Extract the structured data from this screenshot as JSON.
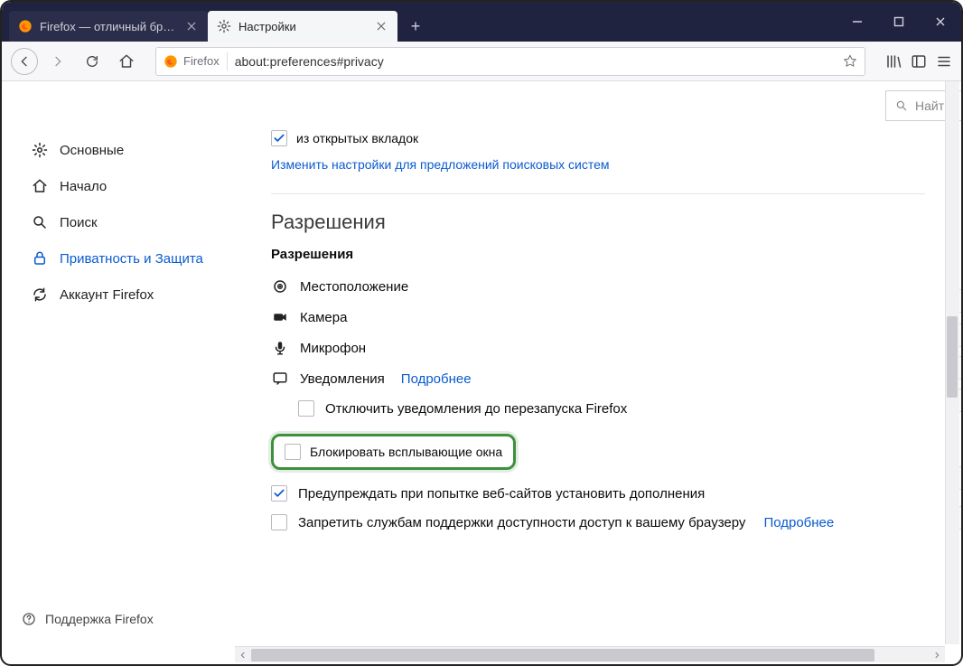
{
  "tabs": [
    {
      "title": "Firefox — отличный браузер д",
      "active": false
    },
    {
      "title": "Настройки",
      "active": true
    }
  ],
  "urlbar": {
    "brand": "Firefox",
    "address": "about:preferences#privacy"
  },
  "sidebar": {
    "items": [
      {
        "label": "Основные",
        "icon": "gear"
      },
      {
        "label": "Начало",
        "icon": "home"
      },
      {
        "label": "Поиск",
        "icon": "search"
      },
      {
        "label": "Приватность и Защита",
        "icon": "lock",
        "active": true
      },
      {
        "label": "Аккаунт Firefox",
        "icon": "sync"
      }
    ],
    "support": "Поддержка Firefox"
  },
  "search_placeholder": "Найт",
  "top_checkbox": {
    "checked": true,
    "label": "из открытых вкладок"
  },
  "search_engine_link": "Изменить настройки для предложений поисковых систем",
  "section_title": "Разрешения",
  "sub_title": "Разрешения",
  "permissions": {
    "location": "Местоположение",
    "camera": "Камера",
    "microphone": "Микрофон",
    "notifications": "Уведомления",
    "notifications_more": "Подробнее",
    "notifications_disable": "Отключить уведомления до перезапуска Firefox",
    "block_popups": "Блокировать всплывающие окна",
    "warn_addons": "Предупреждать при попытке веб-сайтов установить дополнения",
    "a11y_block": "Запретить службам поддержки доступности доступ к вашему браузеру",
    "a11y_more": "Подробнее"
  },
  "checks": {
    "notifications_disable": false,
    "block_popups": false,
    "warn_addons": true,
    "a11y_block": false
  }
}
